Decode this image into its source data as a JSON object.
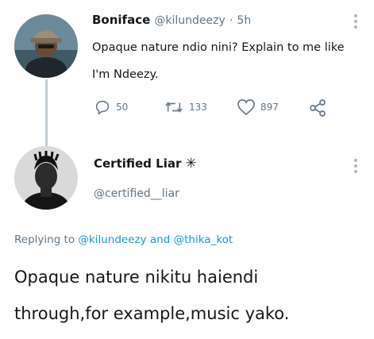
{
  "tweet": {
    "author_name": "Boniface",
    "author_handle": "@kilundeezy",
    "separator": "·",
    "time": "5h",
    "text_line1": "Opaque nature ndio nini? Explain to me like",
    "text_line2": "I'm Ndeezy.",
    "actions": {
      "reply_count": "50",
      "retweet_count": "133",
      "like_count": "897"
    }
  },
  "reply": {
    "author_name": "Certified Liar",
    "author_emoji": "✳",
    "author_handle": "@certified__liar",
    "replying_prefix": "Replying to",
    "replying_mention1": "@kilundeezy",
    "replying_and": "and",
    "replying_mention2": "@thika_kot",
    "text_line1": "Opaque nature nikitu haiendi",
    "text_line2": "through,for example,music yako."
  },
  "icons": {
    "reply": "reply-icon",
    "retweet": "retweet-icon",
    "like": "heart-icon",
    "share": "share-icon",
    "more": "more-options-icon"
  },
  "colors": {
    "text": "#14171a",
    "muted": "#657786",
    "link": "#1b95e0",
    "thread_line": "#c4cfd6"
  }
}
